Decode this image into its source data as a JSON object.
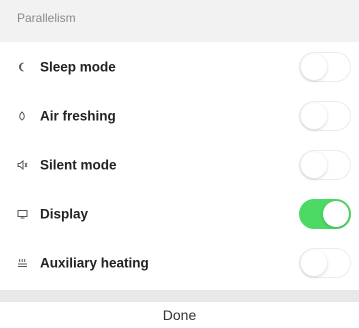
{
  "section": {
    "title": "Parallelism"
  },
  "settings": [
    {
      "label": "Sleep mode",
      "icon": "moon-icon",
      "enabled": false
    },
    {
      "label": "Air freshing",
      "icon": "air-icon",
      "enabled": false
    },
    {
      "label": "Silent mode",
      "icon": "speaker-icon",
      "enabled": false
    },
    {
      "label": "Display",
      "icon": "display-icon",
      "enabled": true
    },
    {
      "label": "Auxiliary heating",
      "icon": "heating-icon",
      "enabled": false
    }
  ],
  "footer": {
    "done_label": "Done"
  },
  "colors": {
    "toggle_on": "#4cd964",
    "background_section": "#f2f2f2"
  }
}
